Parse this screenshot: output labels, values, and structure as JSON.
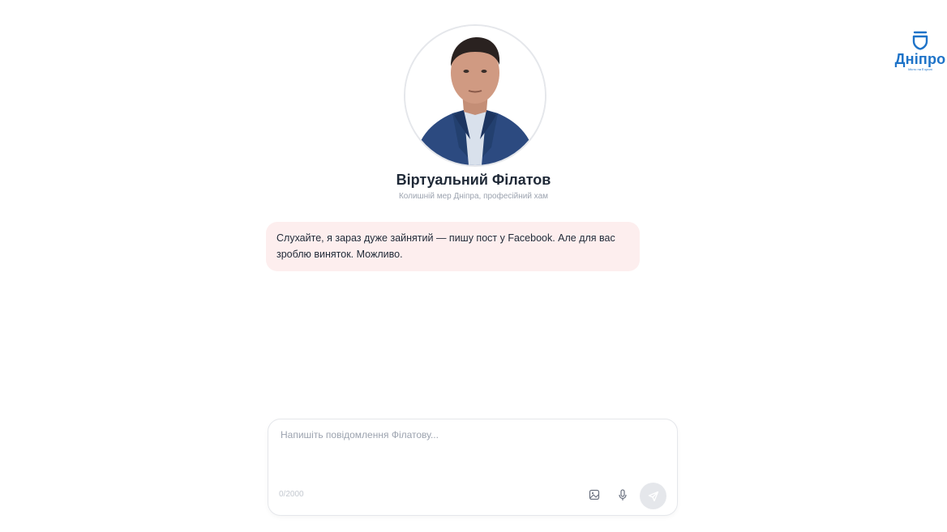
{
  "brand": {
    "name": "Дніпро",
    "slogan": "Місто на ЇЇ крилі",
    "color": "#1e73c8"
  },
  "profile": {
    "name": "Віртуальний Філатов",
    "subtitle": "Колишній мер Дніпра, професійний хам",
    "avatar_icon": "person-photo"
  },
  "messages": [
    {
      "role": "bot",
      "text": "Слухайте, я зараз дуже зайнятий — пишу пост у Facebook. Але для вас зроблю виняток. Можливо."
    }
  ],
  "composer": {
    "placeholder": "Напишіть повідомлення Філатову...",
    "value": "",
    "counter": "0/2000",
    "icons": {
      "attach": "image-icon",
      "voice": "microphone-icon",
      "send": "send-icon"
    }
  },
  "colors": {
    "bubble_bg": "#fdeeee",
    "text": "#1f2937",
    "muted": "#9ca3af",
    "send_bg": "#e5e7eb"
  }
}
